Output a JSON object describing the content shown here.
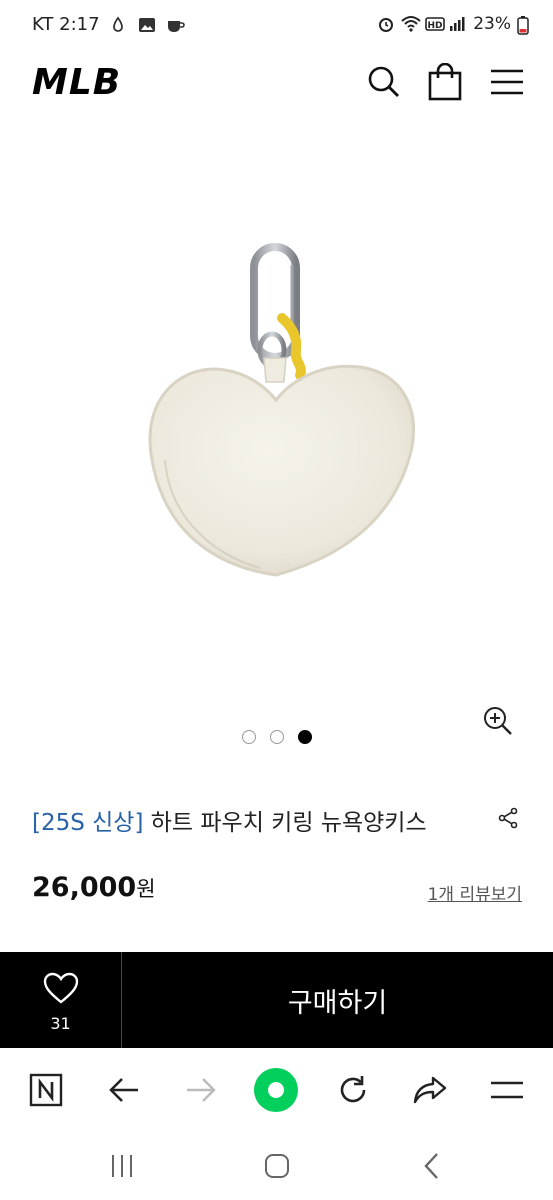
{
  "status_bar": {
    "carrier_time": "KT 2:17",
    "battery": "23%",
    "icons": [
      "alarm-icon",
      "wifi-icon",
      "hd-icon",
      "signal-icon",
      "battery-icon"
    ]
  },
  "header": {
    "logo": "MLB",
    "icons": [
      "search-icon",
      "shopping-bag-icon",
      "menu-icon"
    ]
  },
  "gallery": {
    "slide_count": 3,
    "active_index": 2
  },
  "product": {
    "tag": "[25S 신상]",
    "name": " 하트 파우치 키링 뉴욕양키스",
    "price": "26,000",
    "currency": "원",
    "review_link": "1개 리뷰보기"
  },
  "buy_bar": {
    "like_count": "31",
    "buy_label": "구매하기"
  },
  "browser_toolbar": {
    "icons": [
      "naver-n-icon",
      "back-arrow-icon",
      "forward-arrow-icon",
      "home-dot-icon",
      "refresh-icon",
      "share-arrow-icon",
      "menu-icon"
    ]
  },
  "system_nav": {
    "icons": [
      "recent-apps-icon",
      "home-icon",
      "back-icon"
    ]
  },
  "colors": {
    "tag_blue": "#2a62a8",
    "buy_bar_bg": "#000000",
    "home_green": "#03cf5d"
  }
}
